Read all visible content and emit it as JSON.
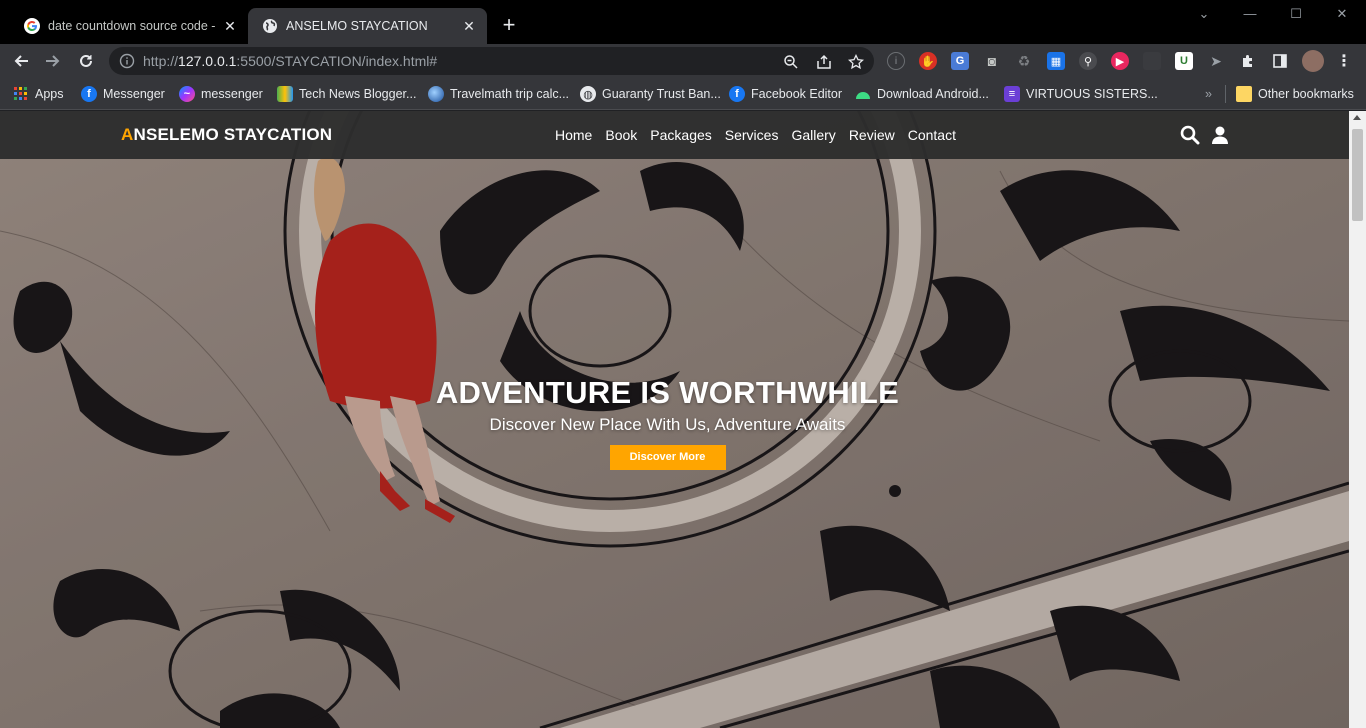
{
  "browser": {
    "tabs": [
      {
        "title": "date countdown source code - G",
        "favicon": "google-icon",
        "active": false
      },
      {
        "title": "ANSELMO STAYCATION",
        "favicon": "globe-icon",
        "active": true
      }
    ],
    "address": {
      "url_prefix": "http://",
      "url_host": "127.0.0.1",
      "url_rest": ":5500/STAYCATION/index.html#"
    },
    "bookmarks": [
      {
        "label": "Apps",
        "icon": "apps-grid-icon"
      },
      {
        "label": "Messenger",
        "icon": "facebook-icon"
      },
      {
        "label": "messenger",
        "icon": "messenger-icon"
      },
      {
        "label": "Tech News Blogger...",
        "icon": "blogger-icon"
      },
      {
        "label": "Travelmath trip calc...",
        "icon": "travelmath-icon"
      },
      {
        "label": "Guaranty Trust Ban...",
        "icon": "globe-icon"
      },
      {
        "label": "Facebook Editor",
        "icon": "facebook-icon"
      },
      {
        "label": "Download Android...",
        "icon": "android-icon"
      },
      {
        "label": "VIRTUOUS SISTERS...",
        "icon": "list-icon"
      }
    ],
    "other_bookmarks": "Other bookmarks",
    "overflow": "»"
  },
  "site": {
    "logo_accent": "A",
    "logo_rest": "NSELEMO STAYCATION",
    "menu": [
      "Home",
      "Book",
      "Packages",
      "Services",
      "Gallery",
      "Review",
      "Contact"
    ],
    "hero": {
      "title": "ADVENTURE IS WORTHWHILE",
      "subtitle": "Discover New Place With Us, Adventure Awaits",
      "cta": "Discover More"
    }
  },
  "colors": {
    "accent": "#ffa500",
    "nav_bg": "#2d2d2d"
  }
}
